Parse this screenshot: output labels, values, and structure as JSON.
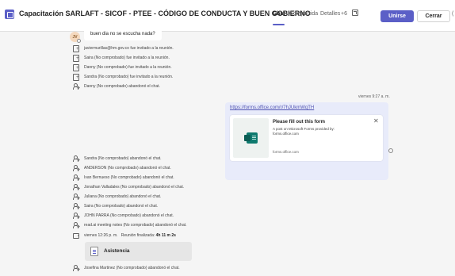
{
  "header": {
    "title": "Capacitación SARLAFT - SICOF - PTEE - CÓDIGO DE CONDUCTA Y BUEN GOBIERNO",
    "tabs": [
      {
        "label": "Chat",
        "active": true
      },
      {
        "label": "Compartida",
        "active": false
      },
      {
        "label": "Detalles",
        "active": false
      },
      {
        "label": "+6",
        "active": false
      }
    ],
    "join_label": "Unirse",
    "close_label": "Cerrar",
    "edge_glyph": "("
  },
  "chat": {
    "first_message": {
      "avatar_initials": "JV",
      "text": "buen dia no se escucha nada?"
    },
    "events_top": [
      {
        "icon": "person-add-icon",
        "text": "javiermurillas@hm.gov.co fue invitado a la reunión."
      },
      {
        "icon": "person-add-icon",
        "text": "Saira (No comprobado) fue invitado a la reunión."
      },
      {
        "icon": "person-add-icon",
        "text": "Danny (No comprobado) fue invitado a la reunión."
      },
      {
        "icon": "person-add-icon",
        "text": "Sandra (No comprobado) fue invitado a la reunión."
      },
      {
        "icon": "person-leave-icon",
        "text": "Danny (No comprobado) abandonó el chat."
      }
    ],
    "own_message": {
      "timestamp": "viernes 9:27 a. m.",
      "link": "https://forms.office.com/r/7hJUkmWqTH",
      "card": {
        "title": "Please fill out this form",
        "description": "A post on Microsoft Forms provided by: forms.office.com",
        "domain": "forms.office.com",
        "close_glyph": "✕"
      }
    },
    "events_bottom": [
      {
        "icon": "person-leave-icon",
        "text": "Sandra (No comprobado) abandonó el chat."
      },
      {
        "icon": "person-leave-icon",
        "text": "ANDERSON (No comprobado) abandonó el chat."
      },
      {
        "icon": "person-leave-icon",
        "text": "Ivan Bernueso (No comprobado) abandonó el chat."
      },
      {
        "icon": "person-leave-icon",
        "text": "Jonathan Valladales (No comprobado) abandonó el chat."
      },
      {
        "icon": "person-leave-icon",
        "text": "Juliana (No comprobado) abandonó el chat."
      },
      {
        "icon": "person-leave-icon",
        "text": "Saira (No comprobado) abandonó el chat."
      },
      {
        "icon": "person-leave-icon",
        "text": "JOHN PARRA (No comprobado) abandonó el chat."
      },
      {
        "icon": "person-leave-icon",
        "text": "read.ai meeting notes (No comprobado) abandonó el chat."
      }
    ],
    "meeting_ended": {
      "icon": "call-icon",
      "time": "viernes 12:26 p. m.",
      "label": "Reunión finalizada:",
      "duration": "4h 11 m 2s"
    },
    "attendance_label": "Asistencia",
    "last_event": {
      "icon": "person-leave-icon",
      "text": "Josefina Martinez (No comprobado) abandonó el chat."
    }
  },
  "colors": {
    "accent": "#5b5fc7",
    "link": "#4f52b2",
    "own_bubble": "#e8ebfa"
  }
}
